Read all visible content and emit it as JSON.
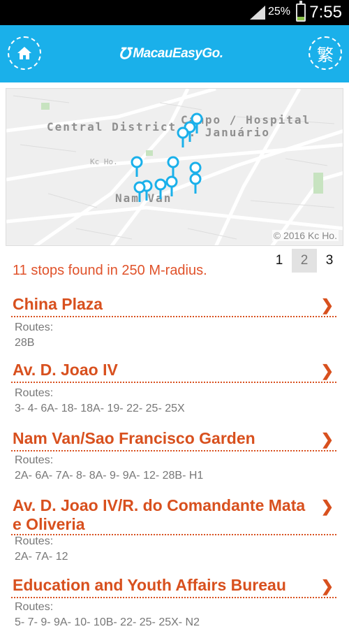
{
  "status": {
    "battery": "25%",
    "time": "7:55"
  },
  "header": {
    "logo": "MacauEasyGo.",
    "lang_label": "繁"
  },
  "map": {
    "districts": [
      "Central District",
      "Campo / Hospital S. Januário",
      "Nam Van"
    ],
    "watermark": "Kc Ho.",
    "copyright": "© 2016 Kc Ho."
  },
  "results": {
    "summary": "11 stops found in 250 M-radius."
  },
  "pager": {
    "pages": [
      "1",
      "2",
      "3"
    ],
    "active": "2"
  },
  "stops": [
    {
      "name": "China Plaza",
      "routes_label": "Routes:",
      "routes": "28B"
    },
    {
      "name": "Av. D. Joao IV",
      "routes_label": "Routes:",
      "routes": "3- 4- 6A- 18- 18A- 19- 22- 25- 25X"
    },
    {
      "name": "Nam Van/Sao Francisco Garden",
      "routes_label": "Routes:",
      "routes": "2A- 6A- 7A- 8- 8A- 9- 9A- 12- 28B- H1"
    },
    {
      "name": "Av. D. Joao IV/R. do Comandante Mata e Oliveria",
      "routes_label": "Routes:",
      "routes": "2A- 7A- 12"
    },
    {
      "name": "Education and Youth Affairs Bureau",
      "routes_label": "Routes:",
      "routes": "5- 7- 9- 9A- 10- 10B- 22- 25- 25X- N2"
    }
  ],
  "colors": {
    "header": "#1ab0ea",
    "accent": "#d8501e",
    "pin": "#1ab0ea"
  }
}
